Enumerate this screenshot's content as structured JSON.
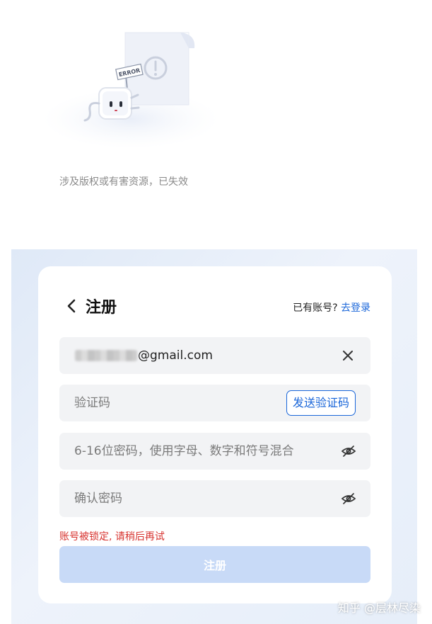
{
  "error_section": {
    "badge_text": "ERROR",
    "message": "涉及版权或有害资源，已失效"
  },
  "register": {
    "title": "注册",
    "login_prompt": "已有账号?",
    "login_link": "去登录",
    "email_value": "@gmail.com",
    "code_placeholder": "验证码",
    "send_code_label": "发送验证码",
    "password_placeholder": "6-16位密码，使用字母、数字和符号混合",
    "confirm_placeholder": "确认密码",
    "error_message": "账号被锁定, 请稍后再试",
    "submit_label": "注册"
  },
  "watermark": "知乎 @层林尽染",
  "colors": {
    "accent": "#1a66d9",
    "error": "#d7322e",
    "submit_disabled": "#c8daf7",
    "field_bg": "#f2f3f5"
  },
  "icons": [
    "back-chevron-icon",
    "clear-icon",
    "eye-closed-icon"
  ]
}
